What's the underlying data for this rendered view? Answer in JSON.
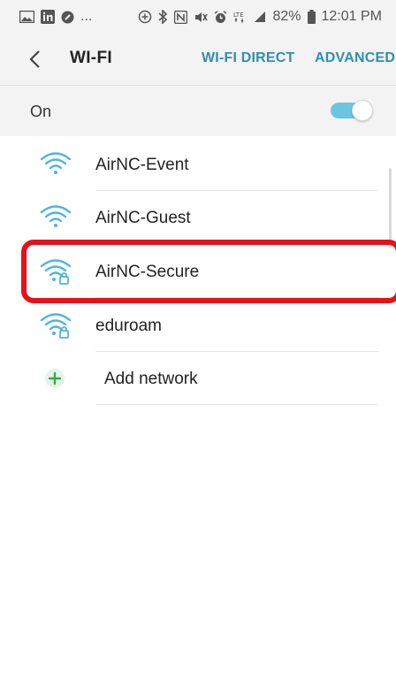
{
  "status_bar": {
    "left_icons": [
      "image-icon",
      "linkedin-icon",
      "circle-icon"
    ],
    "ellipsis": "...",
    "right_icons": [
      "add-circle-icon",
      "bluetooth-icon",
      "nfc-icon",
      "mute-icon",
      "alarm-icon",
      "lte-icon",
      "signal-icon"
    ],
    "battery_percent": "82%",
    "time": "12:01 PM"
  },
  "header": {
    "title": "WI-FI",
    "wifi_direct_label": "WI-FI DIRECT",
    "advanced_label": "ADVANCED"
  },
  "toggle_row": {
    "label": "On",
    "state": true
  },
  "networks": [
    {
      "name": "AirNC-Event",
      "secured": false
    },
    {
      "name": "AirNC-Guest",
      "secured": false
    },
    {
      "name": "AirNC-Secure",
      "secured": true
    },
    {
      "name": "eduroam",
      "secured": true
    }
  ],
  "add_network_label": "Add network",
  "colors": {
    "accent": "#2f8fb0",
    "wifi_icon": "#4db6d9",
    "toggle_track": "#6cc5e1",
    "highlight": "#e8101a",
    "plus_icon": "#3aa84a"
  }
}
